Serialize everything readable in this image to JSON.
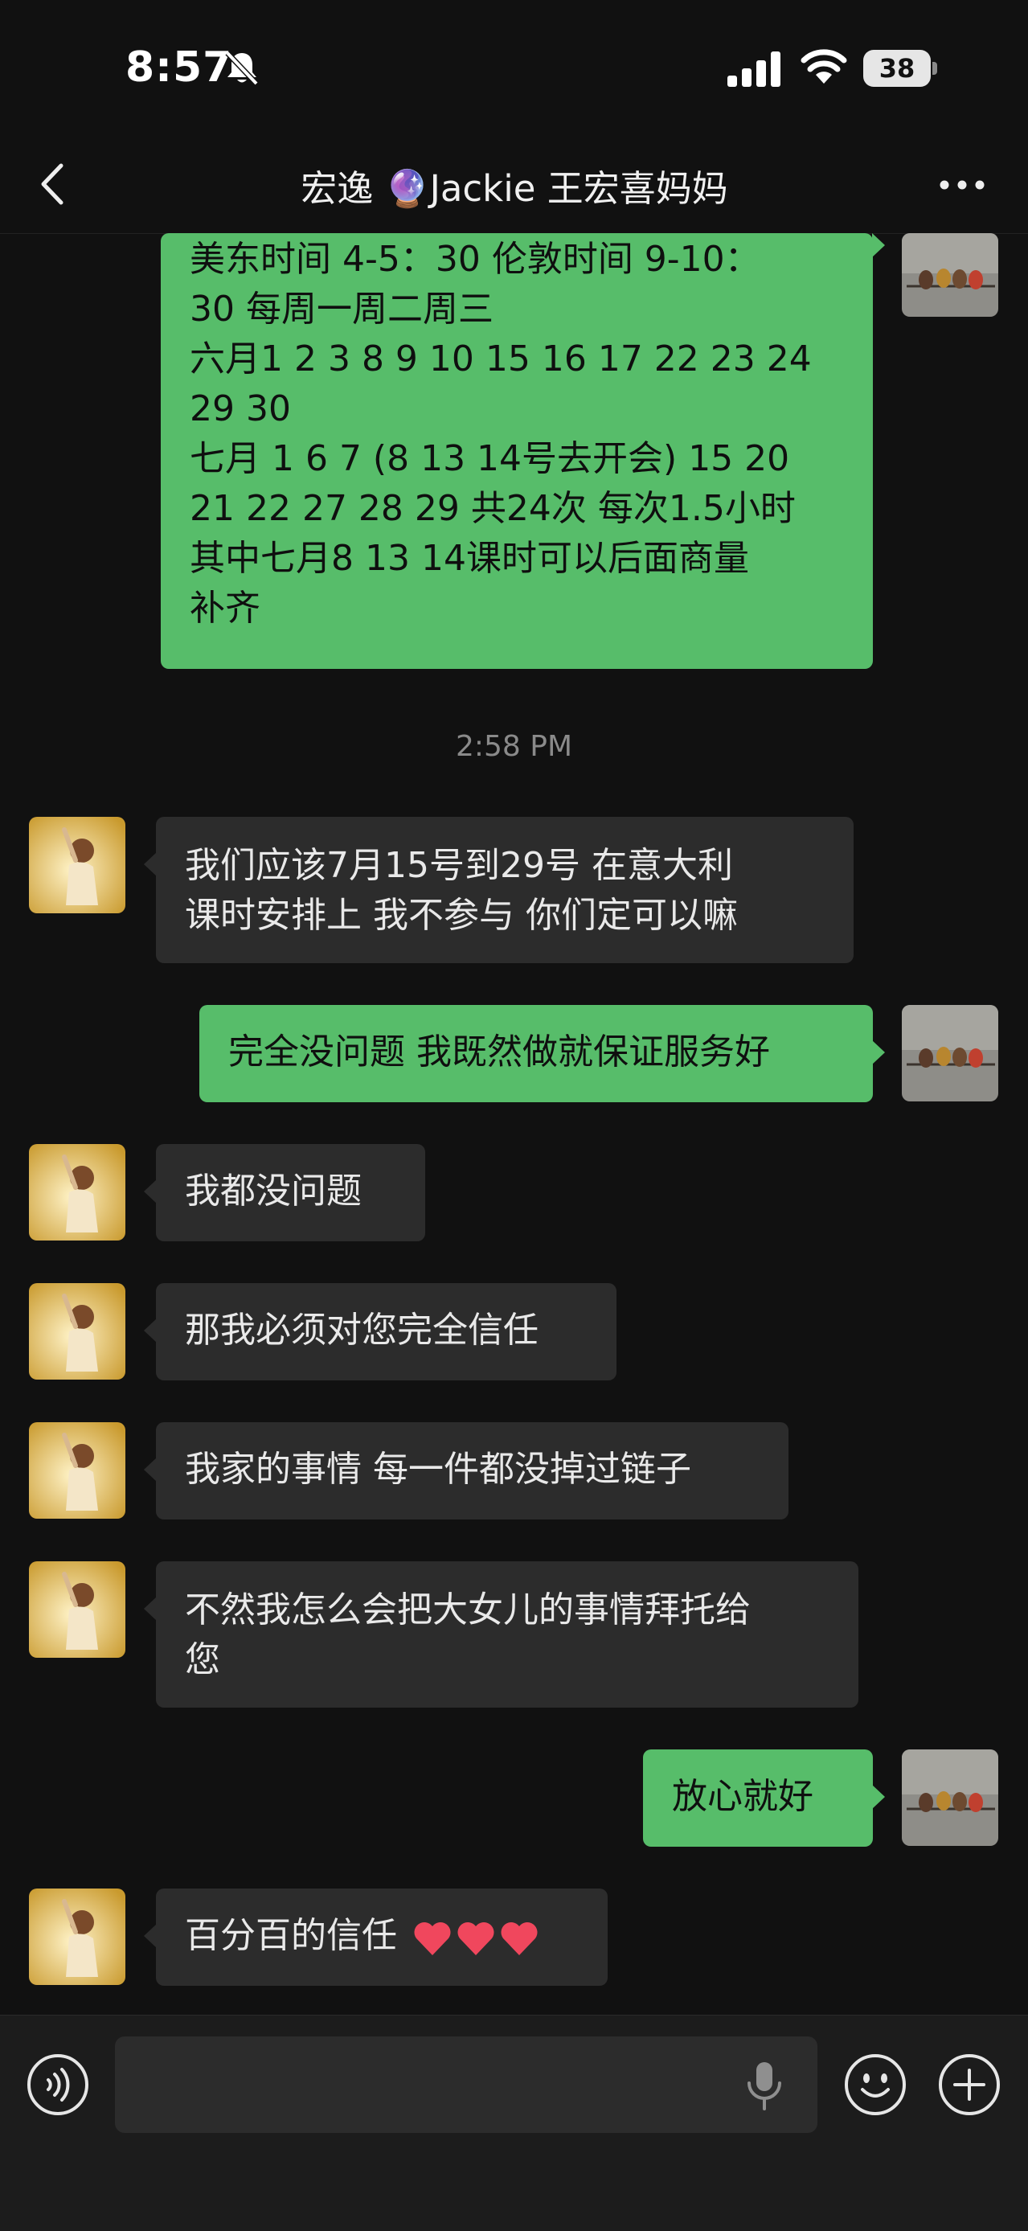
{
  "status_bar": {
    "time": "8:57",
    "battery_level": "38",
    "icons": [
      "bell-slash-icon",
      "signal-icon",
      "wifi-icon",
      "battery-icon"
    ]
  },
  "header": {
    "title": "宏逸 🔮Jackie 王宏喜妈妈",
    "back_icon": "chevron-left-icon",
    "more_icon": "more-dots-icon"
  },
  "timestamp": "2:58 PM",
  "messages": [
    {
      "from": "me",
      "text": "美东时间 4-5：30 伦敦时间 9-10：\n30 每周一周二周三\n六月1 2 3 8 9 10 15 16 17 22 23 24\n29 30\n七月 1 6 7 (8 13 14号去开会) 15 20\n21 22 27 28 29 共24次 每次1.5小时\n其中七月8 13 14课时可以后面商量\n补齐"
    },
    {
      "from": "other",
      "text": "我们应该7月15号到29号 在意大利\n课时安排上 我不参与 你们定可以嘛"
    },
    {
      "from": "me",
      "text": "完全没问题 我既然做就保证服务好"
    },
    {
      "from": "other",
      "text": "我都没问题"
    },
    {
      "from": "other",
      "text": "那我必须对您完全信任"
    },
    {
      "from": "other",
      "text": "我家的事情 每一件都没掉过链子"
    },
    {
      "from": "other",
      "text": "不然我怎么会把大女儿的事情拜托给\n您"
    },
    {
      "from": "me",
      "text": "放心就好"
    },
    {
      "from": "other",
      "text": "百分百的信任",
      "emoji": "❤️❤️❤️"
    }
  ],
  "input_bar": {
    "placeholder": "",
    "voice_icon": "voice-icon",
    "mic_icon": "microphone-icon",
    "emoji_icon": "emoji-icon",
    "plus_icon": "plus-icon"
  },
  "colors": {
    "background": "#111111",
    "incoming_bubble": "#2c2c2c",
    "outgoing_bubble": "#57bd6a",
    "timestamp": "#8a8a8a"
  }
}
